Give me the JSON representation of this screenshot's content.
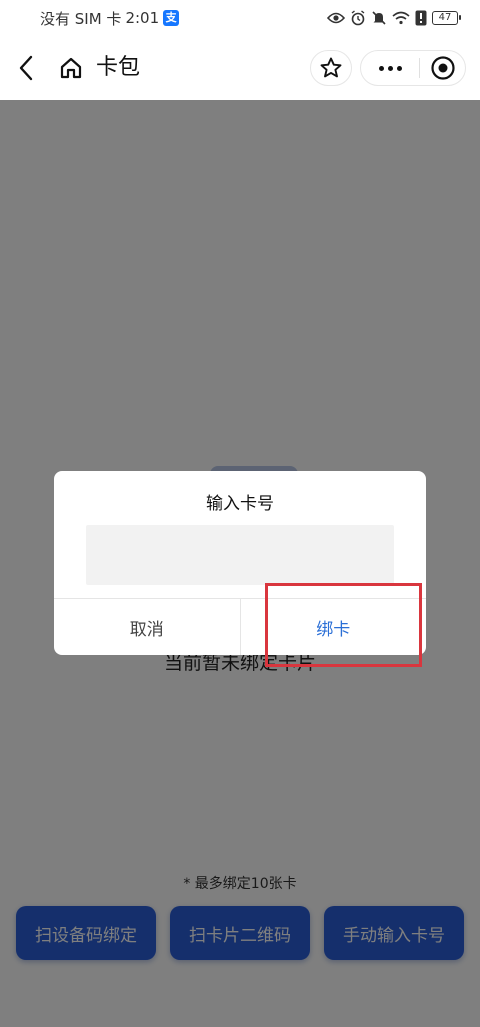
{
  "status_bar": {
    "carrier": "没有 SIM 卡",
    "time": "2:01",
    "app_badge": "支",
    "battery": "47"
  },
  "nav": {
    "title": "卡包",
    "icons": [
      "back-arrow-icon",
      "home-icon",
      "star-icon",
      "more-icon",
      "target-icon"
    ]
  },
  "page": {
    "empty_text": "当前暂未绑定卡片",
    "limit_note": "* 最多绑定10张卡",
    "actions": [
      {
        "label": "扫设备码绑定"
      },
      {
        "label": "扫卡片二维码"
      },
      {
        "label": "手动输入卡号"
      }
    ]
  },
  "dialog": {
    "title": "输入卡号",
    "input_value": "",
    "cancel_label": "取消",
    "confirm_label": "绑卡"
  },
  "colors": {
    "primary": "#2b5fd9",
    "confirm_text": "#2b6fd6",
    "highlight": "#d9363e",
    "mask": "rgba(0,0,0,0.5)"
  }
}
